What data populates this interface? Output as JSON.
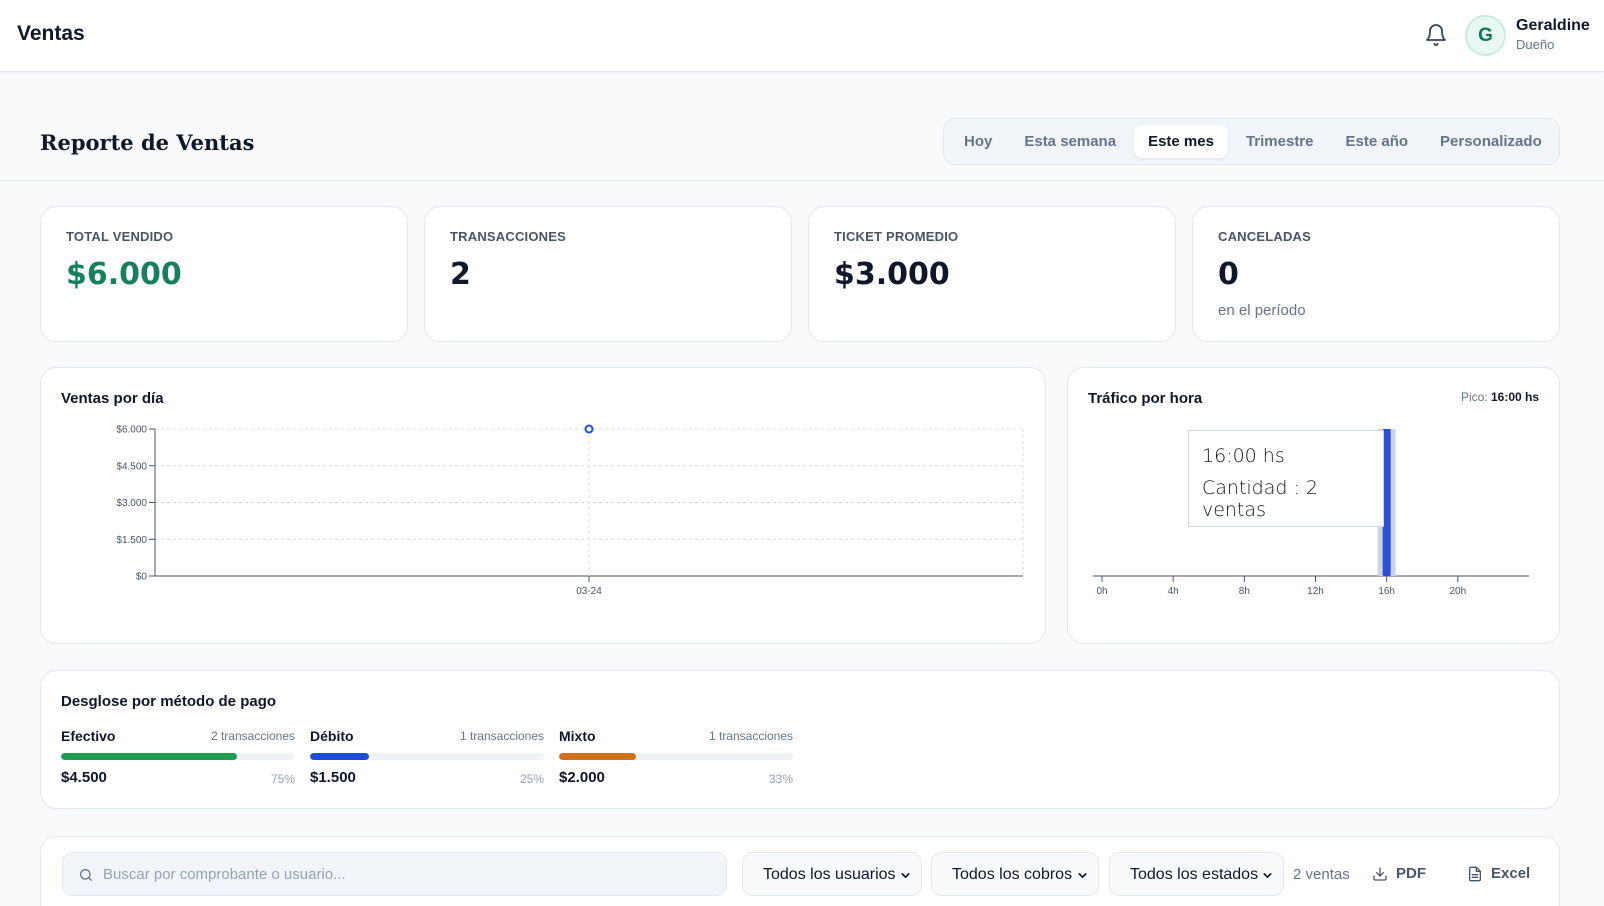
{
  "app": {
    "title": "Ventas"
  },
  "user": {
    "initial": "G",
    "name": "Geraldine",
    "role": "Dueño"
  },
  "page": {
    "title": "Reporte de Ventas"
  },
  "tabs": [
    {
      "label": "Hoy",
      "active": false
    },
    {
      "label": "Esta semana",
      "active": false
    },
    {
      "label": "Este mes",
      "active": true
    },
    {
      "label": "Trimestre",
      "active": false
    },
    {
      "label": "Este año",
      "active": false
    },
    {
      "label": "Personalizado",
      "active": false
    }
  ],
  "stats": {
    "total": {
      "label": "TOTAL VENDIDO",
      "value": "$6.000"
    },
    "transactions": {
      "label": "TRANSACCIONES",
      "value": "2"
    },
    "avg_ticket": {
      "label": "TICKET PROMEDIO",
      "value": "$3.000"
    },
    "cancelled": {
      "label": "CANCELADAS",
      "value": "0",
      "sub": "en el período"
    }
  },
  "daily_card": {
    "title": "Ventas por día"
  },
  "hourly_card": {
    "title": "Tráfico por hora",
    "peak_label": "Pico:",
    "peak_value": "16:00 hs"
  },
  "tooltip": {
    "time": "16:00 hs",
    "label": "Cantidad : 2 ventas"
  },
  "chart_data": [
    {
      "type": "line",
      "title": "Ventas por día",
      "x": [
        "03-24"
      ],
      "series": [
        {
          "values": [
            6000
          ]
        }
      ],
      "yticks": [
        "$0",
        "$1.500",
        "$3.000",
        "$4.500",
        "$6.000"
      ],
      "ylim": [
        0,
        6000
      ],
      "grid": true,
      "color": "#1d4ed8"
    },
    {
      "type": "bar",
      "title": "Tráfico por hora",
      "categories": [
        "16h"
      ],
      "values": [
        2
      ],
      "xticks": [
        "0h",
        "4h",
        "8h",
        "12h",
        "16h",
        "20h"
      ],
      "xlim": [
        0,
        24
      ],
      "color": "#2b4fd8",
      "highlight_color": "#cbd5e1"
    }
  ],
  "payment": {
    "title": "Desglose por método de pago",
    "methods": [
      {
        "name": "Efectivo",
        "count": "2 transacciones",
        "amount": "$4.500",
        "pct": "75%",
        "fraction": 0.75,
        "color": "#1e9e4e"
      },
      {
        "name": "Débito",
        "count": "1 transacciones",
        "amount": "$1.500",
        "pct": "25%",
        "fraction": 0.25,
        "color": "#1d4ed8"
      },
      {
        "name": "Mixto",
        "count": "1 transacciones",
        "amount": "$2.000",
        "pct": "33%",
        "fraction": 0.33,
        "color": "#d0701d"
      }
    ]
  },
  "filters": {
    "search_placeholder": "Buscar por comprobante o usuario...",
    "users": "Todos los usuarios",
    "charges": "Todos los cobros",
    "states": "Todos los estados",
    "count": "2 ventas",
    "pdf": "PDF",
    "excel": "Excel"
  }
}
